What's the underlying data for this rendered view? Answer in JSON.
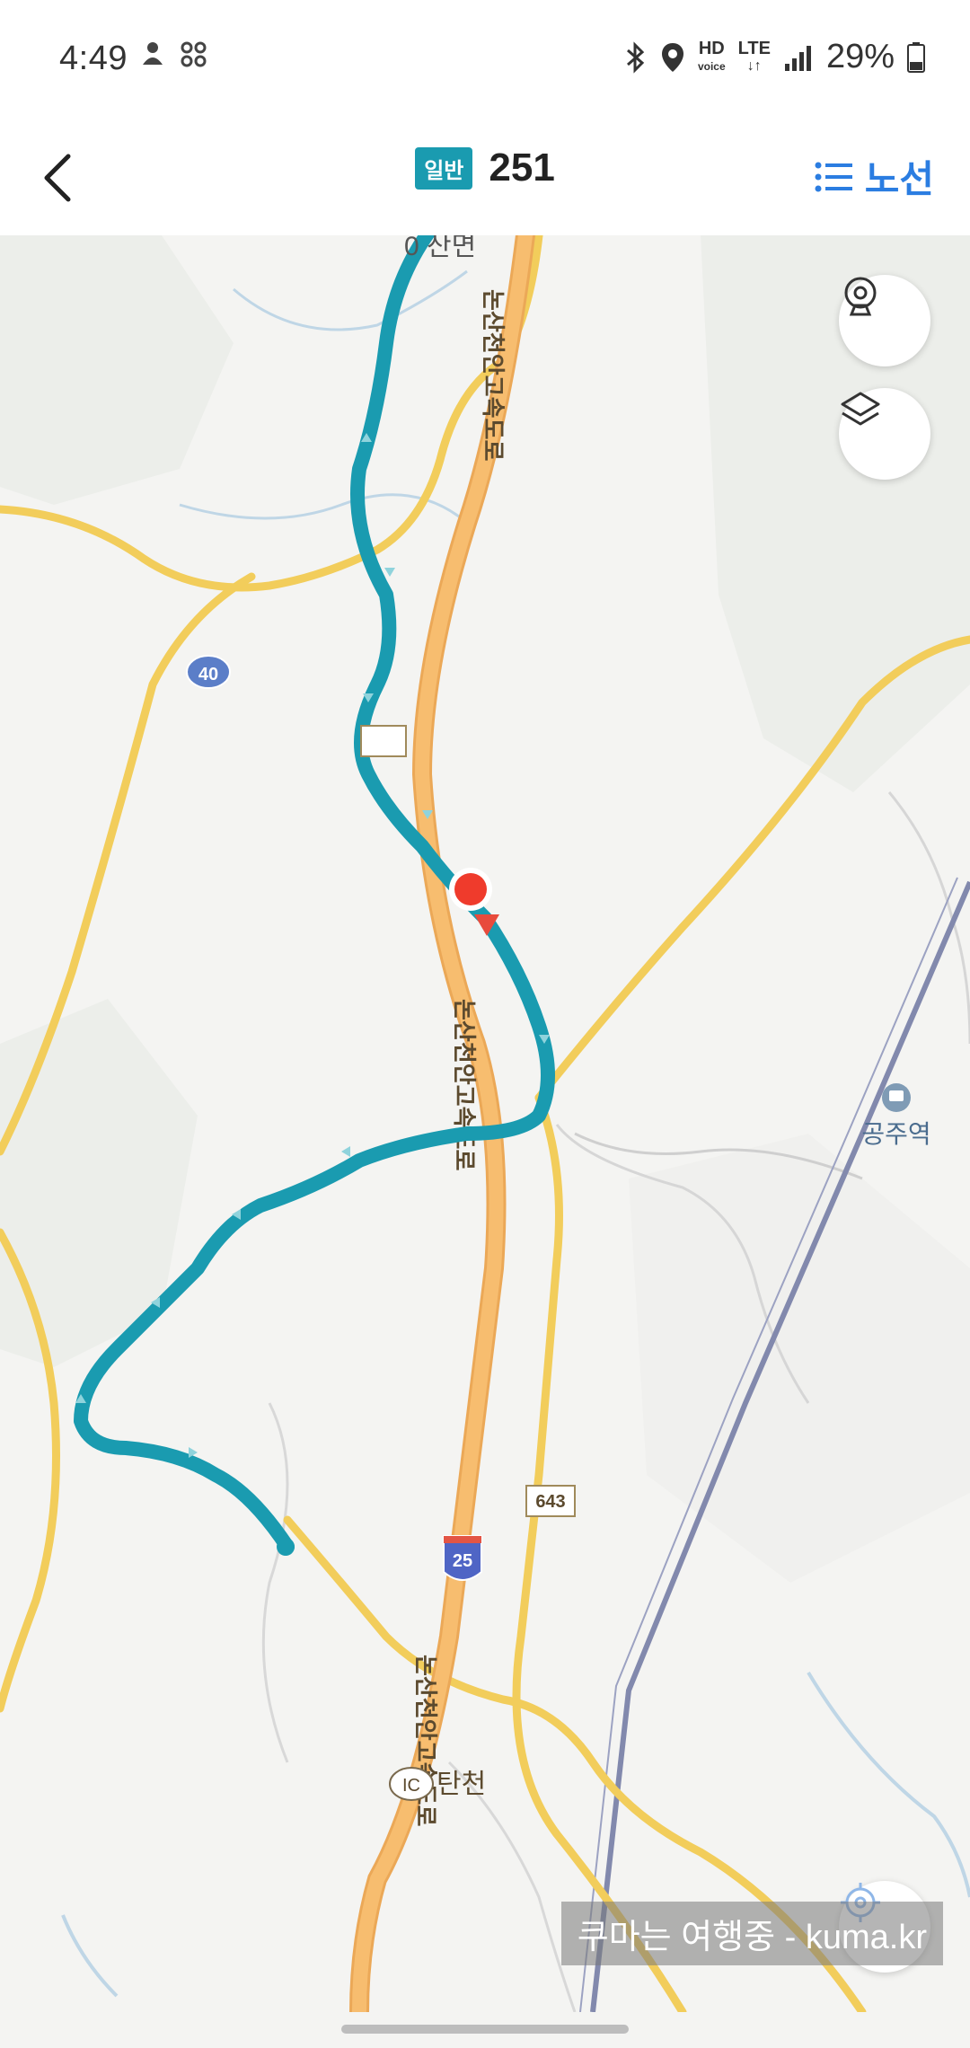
{
  "status_bar": {
    "time": "4:49",
    "battery": "29%",
    "icons": [
      "user-icon",
      "grid-icon",
      "bluetooth-icon",
      "location-icon",
      "hd-voice-icon",
      "lte-icon",
      "signal-icon",
      "battery-icon"
    ],
    "hd_label": "HD",
    "voice_label": "voice",
    "lte_label": "LTE"
  },
  "header": {
    "route_type": "일반",
    "route_number": "251",
    "list_label": "노선"
  },
  "map": {
    "route_color": "#1a9bb0",
    "road_labels": [
      "논산천안고속도로",
      "논산천안고속도로",
      "논산천안고속도로"
    ],
    "station_label": "공주역",
    "place_label": "탄천",
    "ic_label": "IC",
    "top_label": "0 산면",
    "shield_40": "40",
    "shield_25": "25",
    "shield_643": "643"
  },
  "watermark": "쿠마는 여행중 - kuma.kr"
}
